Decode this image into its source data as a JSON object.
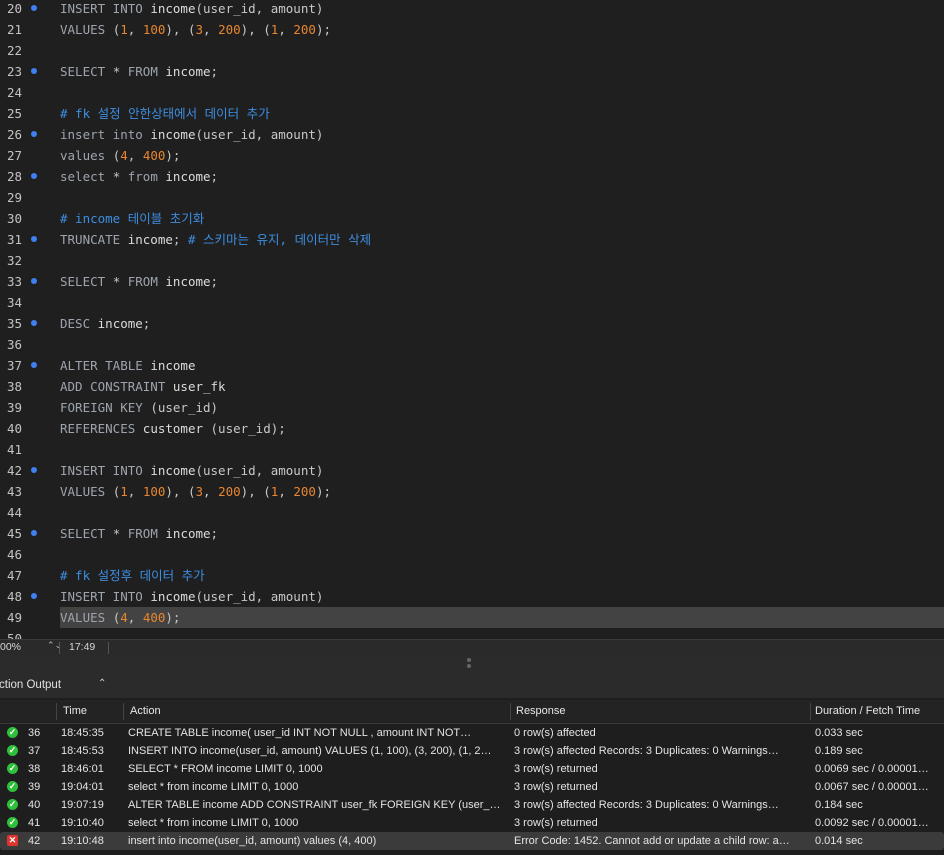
{
  "editor": {
    "lines": [
      {
        "n": "20",
        "dot": true,
        "hl": false,
        "tokens": [
          [
            "kw",
            "INSERT INTO "
          ],
          [
            "id",
            "income"
          ],
          [
            "p",
            "(user_id, amount)"
          ]
        ]
      },
      {
        "n": "21",
        "dot": false,
        "hl": false,
        "tokens": [
          [
            "kw",
            "VALUES "
          ],
          [
            "p",
            "("
          ],
          [
            "num",
            "1"
          ],
          [
            "p",
            ", "
          ],
          [
            "num",
            "100"
          ],
          [
            "p",
            "), ("
          ],
          [
            "num",
            "3"
          ],
          [
            "p",
            ", "
          ],
          [
            "num",
            "200"
          ],
          [
            "p",
            "), ("
          ],
          [
            "num",
            "1"
          ],
          [
            "p",
            ", "
          ],
          [
            "num",
            "200"
          ],
          [
            "p",
            ");"
          ]
        ]
      },
      {
        "n": "22",
        "dot": false,
        "hl": false,
        "tokens": []
      },
      {
        "n": "23",
        "dot": true,
        "hl": false,
        "tokens": [
          [
            "kw",
            "SELECT "
          ],
          [
            "p",
            "* "
          ],
          [
            "kw",
            "FROM "
          ],
          [
            "id",
            "income"
          ],
          [
            "p",
            ";"
          ]
        ]
      },
      {
        "n": "24",
        "dot": false,
        "hl": false,
        "tokens": []
      },
      {
        "n": "25",
        "dot": false,
        "hl": false,
        "tokens": [
          [
            "cm",
            "# fk 설정 안한상태에서 데이터 추가"
          ]
        ]
      },
      {
        "n": "26",
        "dot": true,
        "hl": false,
        "tokens": [
          [
            "kw",
            "insert into "
          ],
          [
            "id",
            "income"
          ],
          [
            "p",
            "(user_id, amount)"
          ]
        ]
      },
      {
        "n": "27",
        "dot": false,
        "hl": false,
        "tokens": [
          [
            "kw",
            "values "
          ],
          [
            "p",
            "("
          ],
          [
            "num",
            "4"
          ],
          [
            "p",
            ", "
          ],
          [
            "num",
            "400"
          ],
          [
            "p",
            ");"
          ]
        ]
      },
      {
        "n": "28",
        "dot": true,
        "hl": false,
        "tokens": [
          [
            "kw",
            "select "
          ],
          [
            "p",
            "* "
          ],
          [
            "kw",
            "from "
          ],
          [
            "id",
            "income"
          ],
          [
            "p",
            ";"
          ]
        ]
      },
      {
        "n": "29",
        "dot": false,
        "hl": false,
        "tokens": []
      },
      {
        "n": "30",
        "dot": false,
        "hl": false,
        "tokens": [
          [
            "cm",
            "# income 테이블 초기화"
          ]
        ]
      },
      {
        "n": "31",
        "dot": true,
        "hl": false,
        "tokens": [
          [
            "kw",
            "TRUNCATE "
          ],
          [
            "id",
            "income"
          ],
          [
            "p",
            "; "
          ],
          [
            "cm",
            "# 스키마는 유지, 데이터만 삭제"
          ]
        ]
      },
      {
        "n": "32",
        "dot": false,
        "hl": false,
        "tokens": []
      },
      {
        "n": "33",
        "dot": true,
        "hl": false,
        "tokens": [
          [
            "kw",
            "SELECT "
          ],
          [
            "p",
            "* "
          ],
          [
            "kw",
            "FROM "
          ],
          [
            "id",
            "income"
          ],
          [
            "p",
            ";"
          ]
        ]
      },
      {
        "n": "34",
        "dot": false,
        "hl": false,
        "tokens": []
      },
      {
        "n": "35",
        "dot": true,
        "hl": false,
        "tokens": [
          [
            "kw",
            "DESC "
          ],
          [
            "id",
            "income"
          ],
          [
            "p",
            ";"
          ]
        ]
      },
      {
        "n": "36",
        "dot": false,
        "hl": false,
        "tokens": []
      },
      {
        "n": "37",
        "dot": true,
        "hl": false,
        "tokens": [
          [
            "kw",
            "ALTER TABLE "
          ],
          [
            "id",
            "income"
          ]
        ]
      },
      {
        "n": "38",
        "dot": false,
        "hl": false,
        "tokens": [
          [
            "kw",
            "ADD CONSTRAINT "
          ],
          [
            "id",
            "user_fk"
          ]
        ]
      },
      {
        "n": "39",
        "dot": false,
        "hl": false,
        "tokens": [
          [
            "kw",
            "FOREIGN KEY "
          ],
          [
            "p",
            "(user_id)"
          ]
        ]
      },
      {
        "n": "40",
        "dot": false,
        "hl": false,
        "tokens": [
          [
            "kw",
            "REFERENCES "
          ],
          [
            "id",
            "customer "
          ],
          [
            "p",
            "(user_id);"
          ]
        ]
      },
      {
        "n": "41",
        "dot": false,
        "hl": false,
        "tokens": []
      },
      {
        "n": "42",
        "dot": true,
        "hl": false,
        "tokens": [
          [
            "kw",
            "INSERT INTO "
          ],
          [
            "id",
            "income"
          ],
          [
            "p",
            "(user_id, amount)"
          ]
        ]
      },
      {
        "n": "43",
        "dot": false,
        "hl": false,
        "tokens": [
          [
            "kw",
            "VALUES "
          ],
          [
            "p",
            "("
          ],
          [
            "num",
            "1"
          ],
          [
            "p",
            ", "
          ],
          [
            "num",
            "100"
          ],
          [
            "p",
            "), ("
          ],
          [
            "num",
            "3"
          ],
          [
            "p",
            ", "
          ],
          [
            "num",
            "200"
          ],
          [
            "p",
            "), ("
          ],
          [
            "num",
            "1"
          ],
          [
            "p",
            ", "
          ],
          [
            "num",
            "200"
          ],
          [
            "p",
            ");"
          ]
        ]
      },
      {
        "n": "44",
        "dot": false,
        "hl": false,
        "tokens": []
      },
      {
        "n": "45",
        "dot": true,
        "hl": false,
        "tokens": [
          [
            "kw",
            "SELECT "
          ],
          [
            "p",
            "* "
          ],
          [
            "kw",
            "FROM "
          ],
          [
            "id",
            "income"
          ],
          [
            "p",
            ";"
          ]
        ]
      },
      {
        "n": "46",
        "dot": false,
        "hl": false,
        "tokens": []
      },
      {
        "n": "47",
        "dot": false,
        "hl": false,
        "tokens": [
          [
            "cm",
            "# fk 설정후 데이터 추가"
          ]
        ]
      },
      {
        "n": "48",
        "dot": true,
        "hl": false,
        "tokens": [
          [
            "kw",
            "INSERT INTO "
          ],
          [
            "id",
            "income"
          ],
          [
            "p",
            "(user_id, amount)"
          ]
        ]
      },
      {
        "n": "49",
        "dot": false,
        "hl": true,
        "tokens": [
          [
            "kw",
            "VALUES "
          ],
          [
            "p",
            "("
          ],
          [
            "num",
            "4"
          ],
          [
            "p",
            ", "
          ],
          [
            "num",
            "400"
          ],
          [
            "p",
            ");"
          ]
        ]
      },
      {
        "n": "50",
        "dot": false,
        "hl": false,
        "tokens": []
      }
    ]
  },
  "status": {
    "zoom": "00%",
    "cursor": "17:49"
  },
  "output": {
    "selector_label": "ction Output",
    "columns": {
      "time": "Time",
      "action": "Action",
      "response": "Response",
      "duration": "Duration / Fetch Time"
    },
    "rows": [
      {
        "ok": true,
        "num": "36",
        "time": "18:45:35",
        "action": "CREATE TABLE income(  user_id INT NOT NULL     , amount INT NOT…",
        "response": "0 row(s) affected",
        "duration": "0.033 sec"
      },
      {
        "ok": true,
        "num": "37",
        "time": "18:45:53",
        "action": "INSERT INTO income(user_id, amount) VALUES (1, 100), (3, 200), (1, 2…",
        "response": "3 row(s) affected Records: 3  Duplicates: 0  Warnings…",
        "duration": "0.189 sec"
      },
      {
        "ok": true,
        "num": "38",
        "time": "18:46:01",
        "action": "SELECT * FROM income LIMIT 0, 1000",
        "response": "3 row(s) returned",
        "duration": "0.0069 sec / 0.00001…"
      },
      {
        "ok": true,
        "num": "39",
        "time": "19:04:01",
        "action": "select * from income LIMIT 0, 1000",
        "response": "3 row(s) returned",
        "duration": "0.0067 sec / 0.00001…"
      },
      {
        "ok": true,
        "num": "40",
        "time": "19:07:19",
        "action": "ALTER TABLE income ADD CONSTRAINT user_fk FOREIGN KEY (user_…",
        "response": "3 row(s) affected Records: 3  Duplicates: 0  Warnings…",
        "duration": "0.184 sec"
      },
      {
        "ok": true,
        "num": "41",
        "time": "19:10:40",
        "action": "select * from income LIMIT 0, 1000",
        "response": "3 row(s) returned",
        "duration": "0.0092 sec / 0.00001…"
      },
      {
        "ok": false,
        "num": "42",
        "time": "19:10:48",
        "action": "insert into income(user_id, amount) values (4, 400)",
        "response": "Error Code: 1452. Cannot add or update a child row: a…",
        "duration": "0.014 sec"
      }
    ]
  }
}
